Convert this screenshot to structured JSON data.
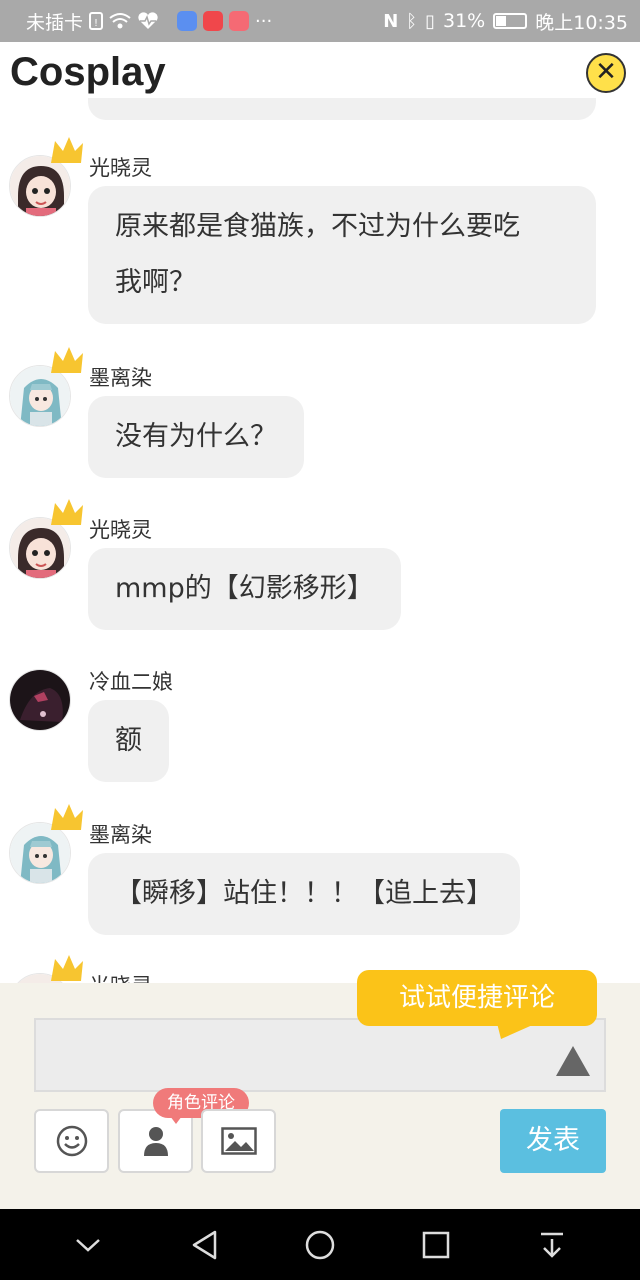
{
  "status_bar": {
    "carrier": "未插卡",
    "battery": "31%",
    "battery_level": 0.31,
    "time": "晚上10:35"
  },
  "header": {
    "title": "Cosplay",
    "close_icon": "close-icon"
  },
  "messages": [
    {
      "user": "光晓灵",
      "text": "原来都是食猫族，不过为什么要吃我啊？",
      "line1": "原来都是食猫族，不过为什么要吃",
      "line2": "我啊？"
    },
    {
      "user": "墨离染",
      "text": "没有为什么？"
    },
    {
      "user": "光晓灵",
      "text": "mmp的【幻影移形】"
    },
    {
      "user": "冷血二娘",
      "text": "额"
    },
    {
      "user": "墨离染",
      "text": "【瞬移】站住！！！【追上去】"
    },
    {
      "user": "光晓灵",
      "text": ""
    }
  ],
  "composer": {
    "tip": "试试便捷评论",
    "role_badge": "角色评论",
    "send_label": "发表"
  },
  "colors": {
    "bubble": "#f0f0f0",
    "tip": "#fbc318",
    "send": "#5bbfe0",
    "badge": "#f07a7a",
    "crown": "#f7c530"
  }
}
